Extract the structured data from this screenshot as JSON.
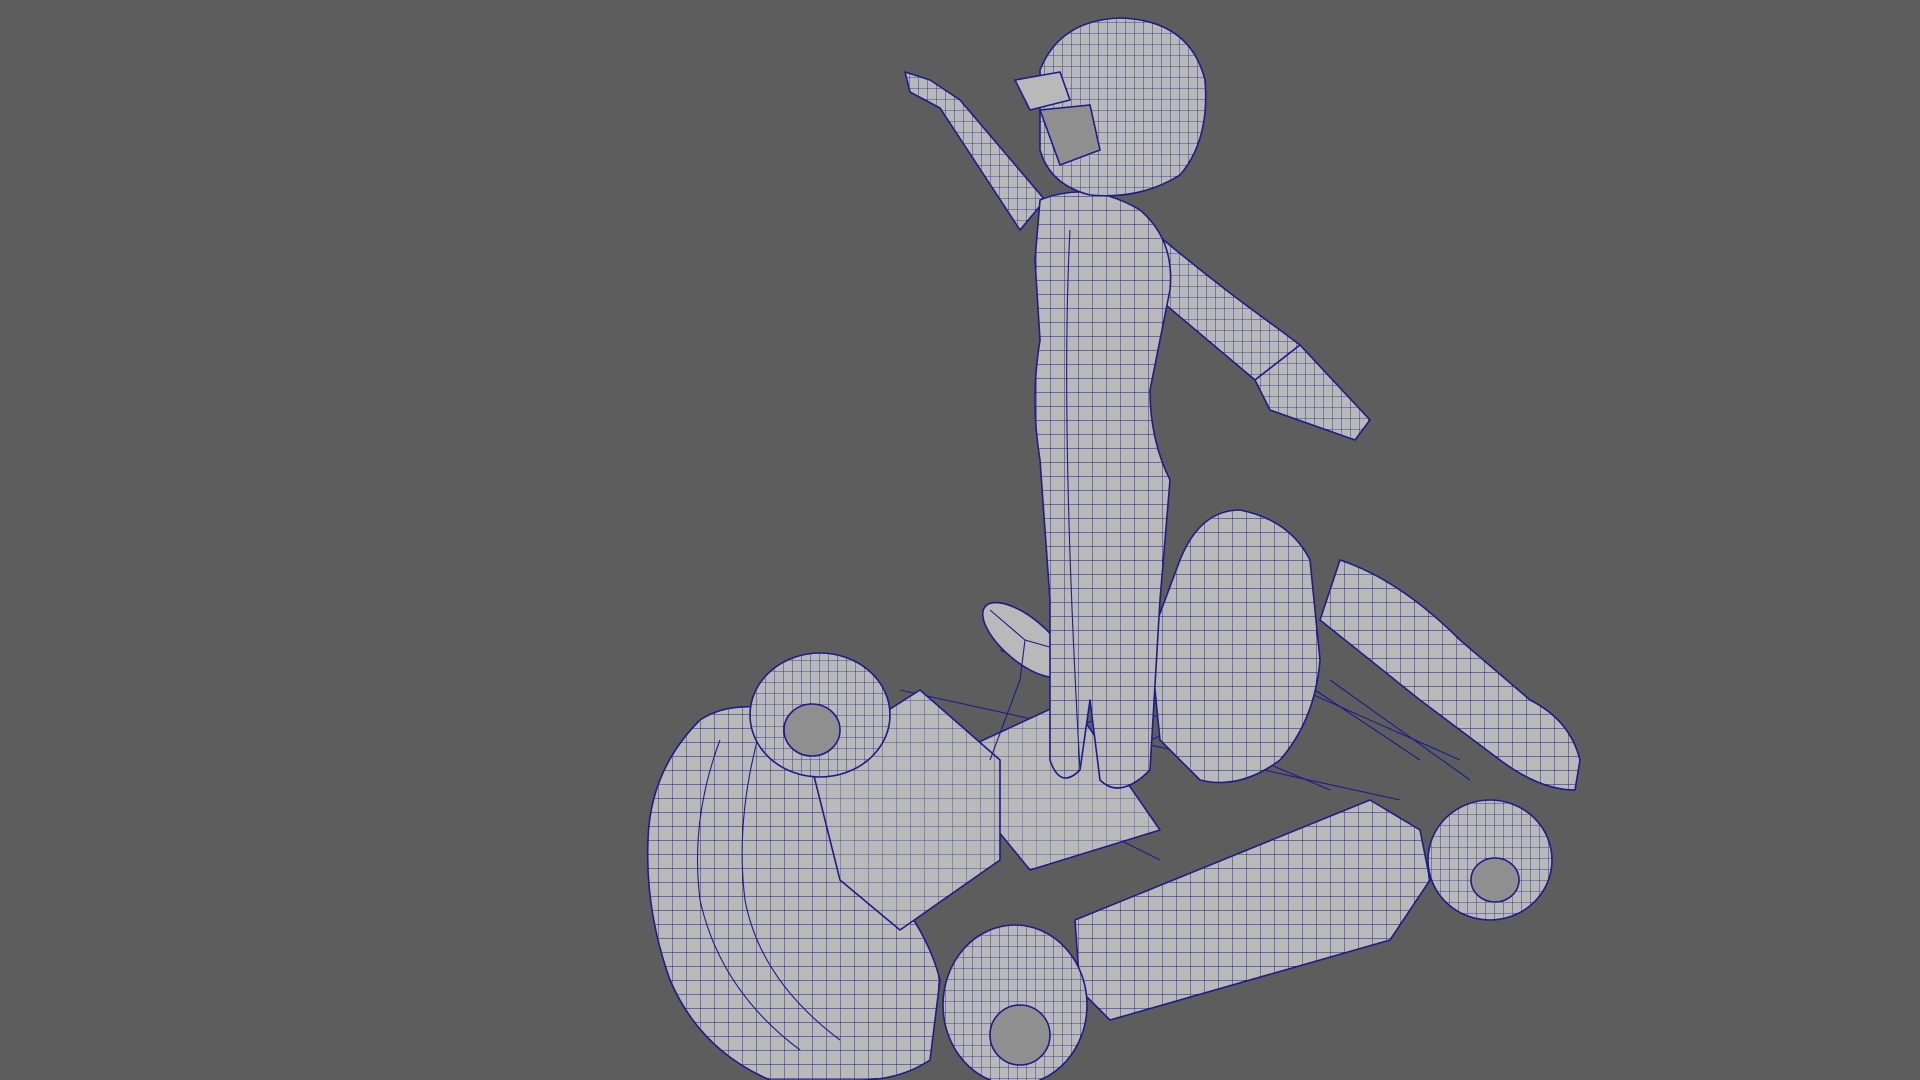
{
  "app": {
    "window": "3d-viewport",
    "view": "perspective",
    "display_mode": "wireframe-on-shaded"
  },
  "scene": {
    "objects": [
      "driver-character",
      "go-kart"
    ]
  },
  "colors": {
    "background": "#5d5d5d",
    "surface": "#b9b9b9",
    "wireframe": "#1c1c8c"
  }
}
